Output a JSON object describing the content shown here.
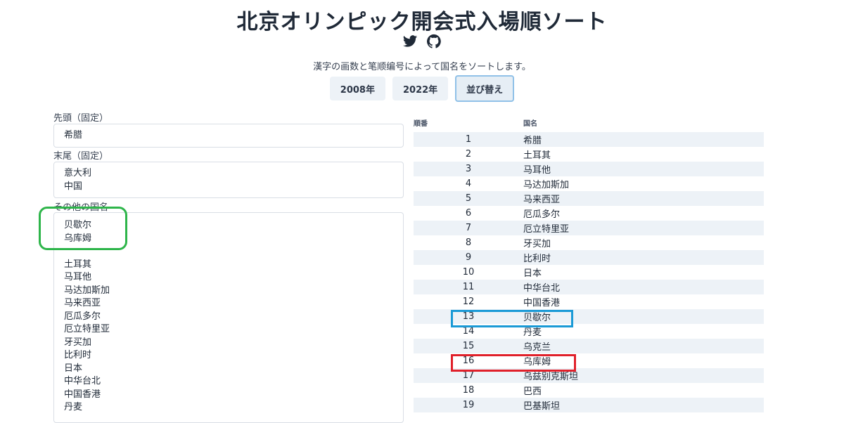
{
  "title": "北京オリンピック開会式入場順ソート",
  "subtitle": "漢字の画数と笔顺编号によって国名をソートします。",
  "icons": [
    "twitter-icon",
    "github-icon"
  ],
  "buttons": {
    "y2008": "2008年",
    "y2022": "2022年",
    "sort": "並び替え"
  },
  "sections": {
    "head_label": "先頭（固定）",
    "head_items": [
      "希腊"
    ],
    "tail_label": "末尾（固定）",
    "tail_items": [
      "意大利",
      "中国"
    ],
    "others_label": "その他の国名",
    "others_items": [
      "贝歇尔",
      "乌库姆",
      "",
      "土耳其",
      "马耳他",
      "马达加斯加",
      "马来西亚",
      "厄瓜多尔",
      "厄立特里亚",
      "牙买加",
      "比利时",
      "日本",
      "中华台北",
      "中国香港",
      "丹麦"
    ]
  },
  "table": {
    "headers": {
      "order": "順番",
      "country": "国名"
    },
    "rows": [
      {
        "n": "1",
        "name": "希腊"
      },
      {
        "n": "2",
        "name": "土耳其"
      },
      {
        "n": "3",
        "name": "马耳他"
      },
      {
        "n": "4",
        "name": "马达加斯加"
      },
      {
        "n": "5",
        "name": "马来西亚"
      },
      {
        "n": "6",
        "name": "厄瓜多尔"
      },
      {
        "n": "7",
        "name": "厄立特里亚"
      },
      {
        "n": "8",
        "name": "牙买加"
      },
      {
        "n": "9",
        "name": "比利时"
      },
      {
        "n": "10",
        "name": "日本"
      },
      {
        "n": "11",
        "name": "中华台北"
      },
      {
        "n": "12",
        "name": "中国香港"
      },
      {
        "n": "13",
        "name": "贝歇尔"
      },
      {
        "n": "14",
        "name": "丹麦"
      },
      {
        "n": "15",
        "name": "乌克兰"
      },
      {
        "n": "16",
        "name": "乌库姆"
      },
      {
        "n": "17",
        "name": "乌兹别克斯坦"
      },
      {
        "n": "18",
        "name": "巴西"
      },
      {
        "n": "19",
        "name": "巴基斯坦"
      }
    ]
  },
  "colors": {
    "green_highlight": "#2eb54a",
    "blue_highlight": "#1a9ad6",
    "red_highlight": "#e0202a"
  }
}
